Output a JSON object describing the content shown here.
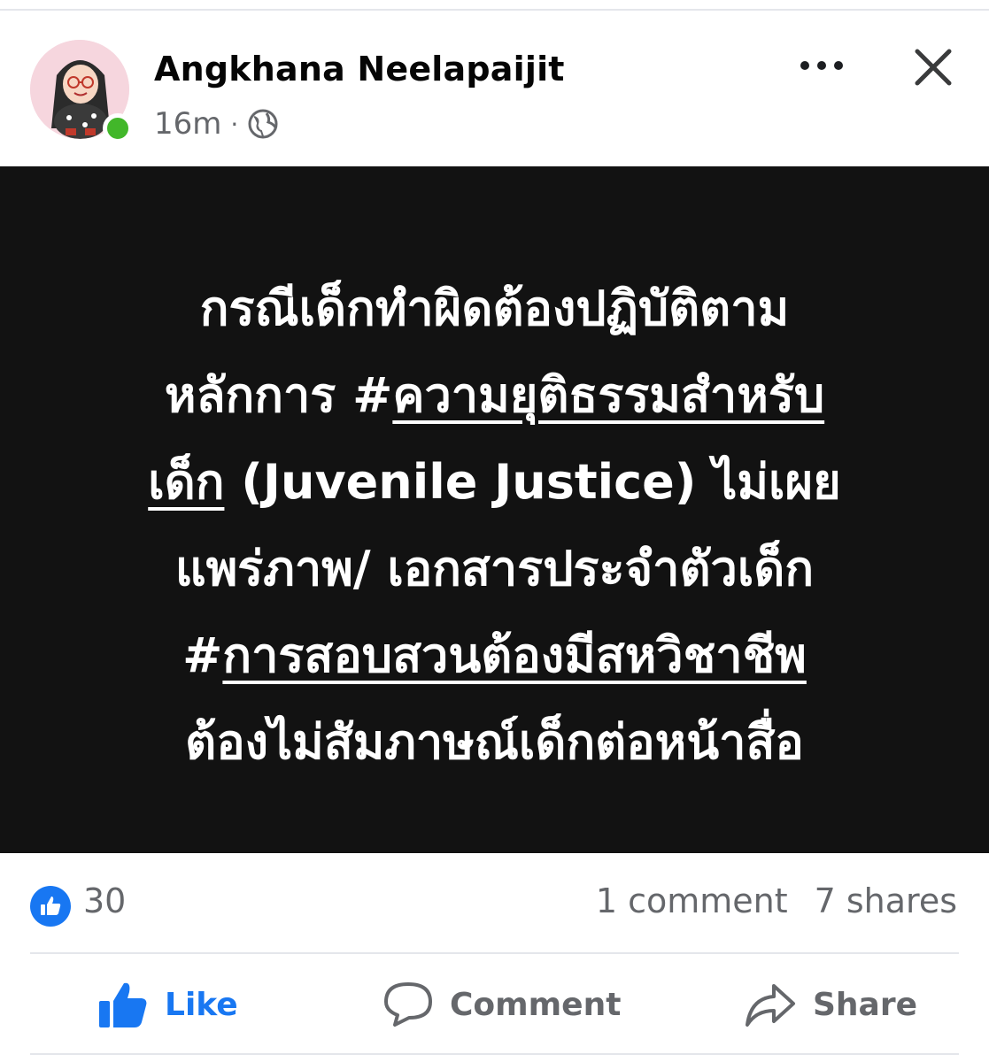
{
  "post": {
    "author": "Angkhana Neelapaijit",
    "timestamp": "16m",
    "separator": "·",
    "privacy_icon": "globe-icon",
    "more_icon": "more-dots-icon",
    "close_icon": "close-icon"
  },
  "image_text": {
    "line1": "กรณีเด็กทำผิดต้องปฏิบัติตาม",
    "line2_prefix": "หลักการ ",
    "line2_hashtag": "#",
    "line2_link": "ความยุติธรรมสำหรับ",
    "line3_link": "เด็ก",
    "line3_rest": " (Juvenile Justice) ไม่เผย",
    "line4": "แพร่ภาพ/ เอกสารประจำตัวเด็ก",
    "line5_hashtag": "#",
    "line5_link": "การสอบสวนต้องมีสหวิชาชีพ",
    "line6": "ต้องไม่สัมภาษณ์เด็กต่อหน้าสื่อ"
  },
  "stats": {
    "likes": "30",
    "comments": "1 comment",
    "shares": "7 shares"
  },
  "actions": {
    "like_label": "Like",
    "comment_label": "Comment",
    "share_label": "Share"
  },
  "colors": {
    "accent": "#1877f2",
    "secondary_text": "#65676b",
    "image_bg": "#121212",
    "online": "#42b72a"
  }
}
